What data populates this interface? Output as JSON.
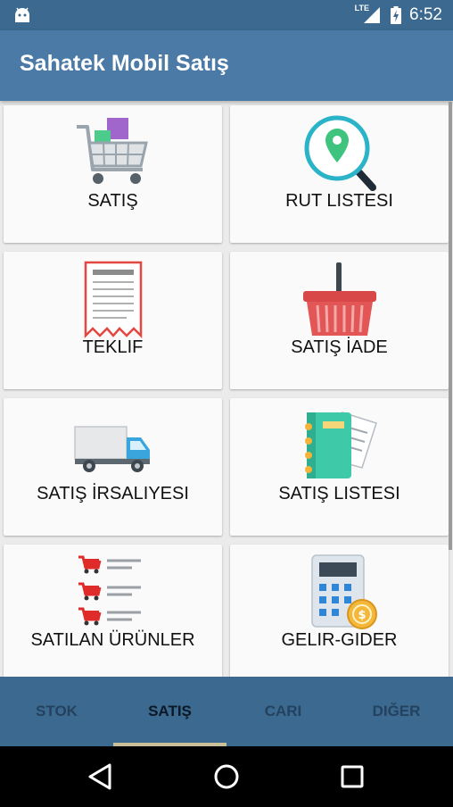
{
  "status_bar": {
    "time": "6:52",
    "network": "LTE",
    "icons": [
      "android-icon",
      "signal-icon",
      "battery-charging-icon"
    ]
  },
  "app": {
    "title": "Sahatek Mobil Satış",
    "colors": {
      "app_bar": "#4a7aa5",
      "status_bar": "#3b698f",
      "tab_bar": "#3b698f"
    }
  },
  "menu": {
    "items": [
      {
        "label": "SATIŞ",
        "icon": "shopping-cart-icon"
      },
      {
        "label": "RUT LISTESI",
        "icon": "map-pin-search-icon"
      },
      {
        "label": "TEKLIF",
        "icon": "receipt-icon"
      },
      {
        "label": "SATIŞ İADE",
        "icon": "basket-icon"
      },
      {
        "label": "SATIŞ İRSALIYESI",
        "icon": "delivery-truck-icon"
      },
      {
        "label": "SATIŞ LISTESI",
        "icon": "notebook-icon"
      },
      {
        "label": "SATILAN ÜRÜNLER",
        "icon": "cart-list-icon"
      },
      {
        "label": "GELIR-GIDER",
        "icon": "calculator-coin-icon"
      }
    ]
  },
  "tabs": [
    {
      "label": "STOK",
      "active": false
    },
    {
      "label": "SATIŞ",
      "active": true
    },
    {
      "label": "CARI",
      "active": false
    },
    {
      "label": "DIĞER",
      "active": false
    }
  ],
  "nav_bar": {
    "buttons": [
      "back-icon",
      "home-icon",
      "recents-icon"
    ]
  }
}
